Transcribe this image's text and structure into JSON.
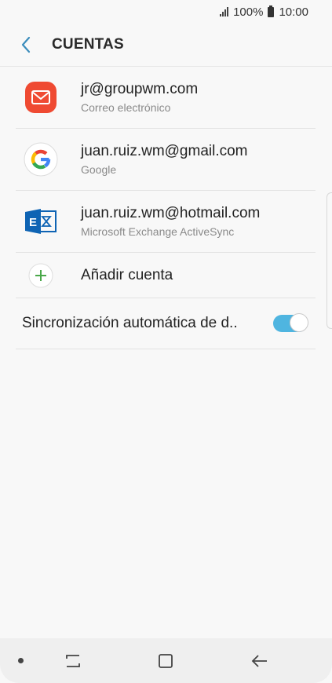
{
  "status_bar": {
    "battery_text": "100%",
    "time": "10:00",
    "icons": [
      "signal-icon",
      "battery-icon"
    ]
  },
  "header": {
    "title": "CUENTAS",
    "back_icon": "chevron-left-icon"
  },
  "accounts": [
    {
      "email": "jr@groupwm.com",
      "type": "Correo electrónico",
      "icon": "email-app-icon"
    },
    {
      "email": "juan.ruiz.wm@gmail.com",
      "type": "Google",
      "icon": "google-icon"
    },
    {
      "email": "juan.ruiz.wm@hotmail.com",
      "type": "Microsoft Exchange ActiveSync",
      "icon": "exchange-icon"
    }
  ],
  "add_account": {
    "label": "Añadir cuenta",
    "icon": "plus-icon"
  },
  "auto_sync": {
    "label": "Sincronización automática de d..",
    "enabled": true
  },
  "colors": {
    "accent": "#4fb5e0",
    "email_icon": "#ef4a32",
    "exchange_icon": "#0f64b4",
    "plus_icon": "#4aa84a"
  },
  "nav_bar": {
    "icons": [
      "dot-icon",
      "recent-apps-icon",
      "home-icon",
      "back-arrow-icon"
    ]
  }
}
